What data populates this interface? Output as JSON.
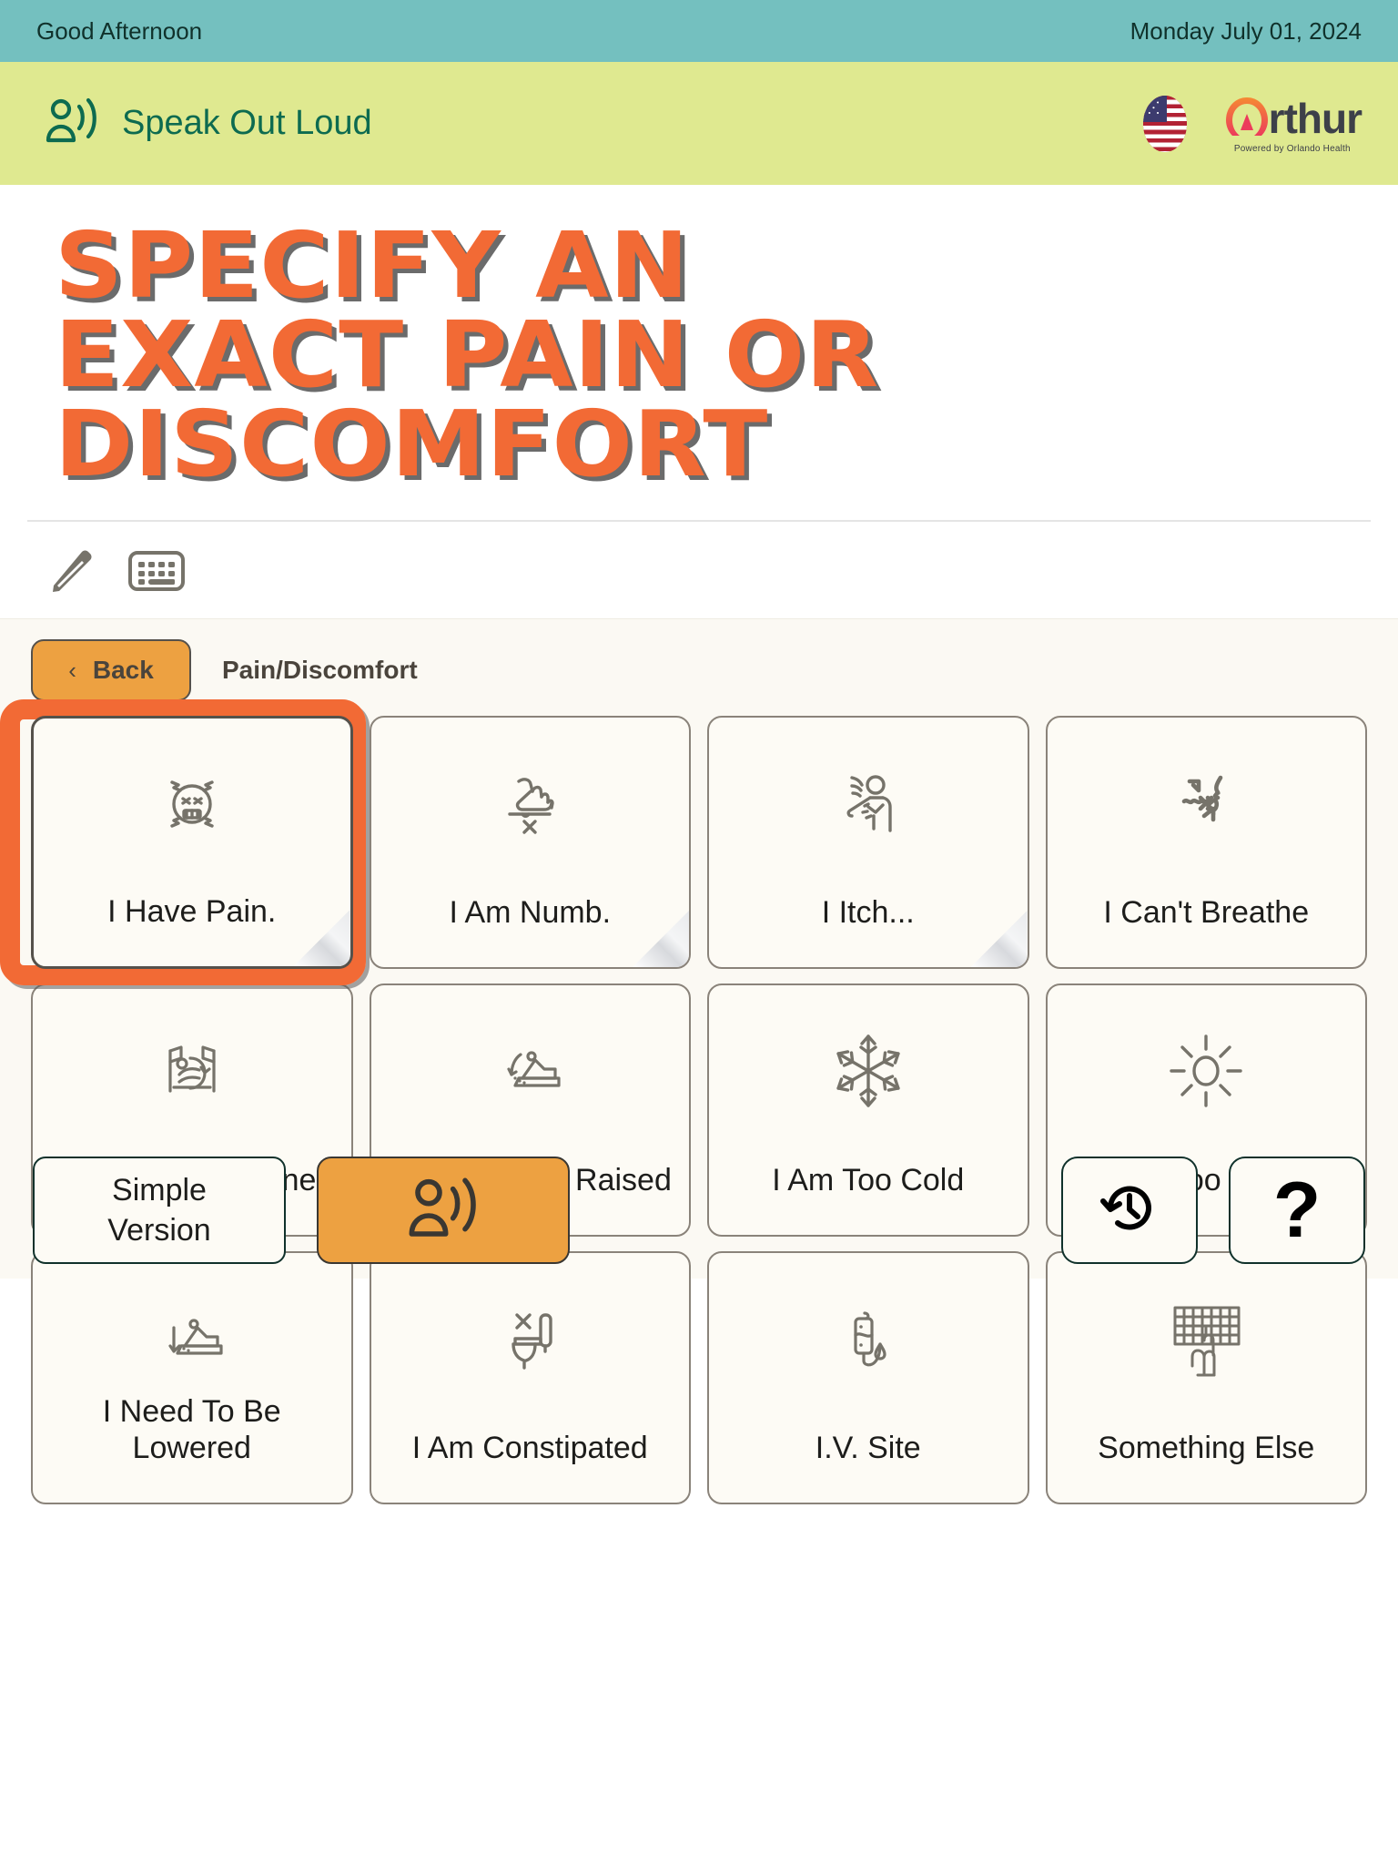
{
  "header": {
    "greeting": "Good Afternoon",
    "date": "Monday July 01, 2024"
  },
  "speak_bar": {
    "label": "Speak Out Loud",
    "speak_icon": "speak-out-loud-icon",
    "language_flag": "us-flag-icon",
    "brand": {
      "a_letter": "A",
      "rest": "rthur",
      "tagline": "Powered by Orlando Health"
    }
  },
  "page": {
    "title": "Specify An Exact Pain Or Discomfort",
    "title_lines": [
      "SPECIFY AN",
      "EXACT PAIN OR",
      "DISCOMFORT"
    ]
  },
  "toolbar": {
    "items": [
      {
        "name": "pencil-icon",
        "label": "Draw"
      },
      {
        "name": "keyboard-icon",
        "label": "Keyboard"
      }
    ]
  },
  "panel": {
    "back_label": "Back",
    "back_chevron": "‹",
    "breadcrumb": "Pain/Discomfort",
    "cards": [
      {
        "label": "I Have Pain.",
        "icon": "pain-face-icon",
        "curl": true,
        "selected": true
      },
      {
        "label": "I Am Numb.",
        "icon": "numb-hand-icon",
        "curl": true,
        "selected": false
      },
      {
        "label": "I Itch...",
        "icon": "itch-person-icon",
        "curl": true,
        "selected": false
      },
      {
        "label": "I Can't Breathe",
        "icon": "cant-breathe-icon",
        "curl": false,
        "selected": false
      },
      {
        "label": "I Need To Be Turned",
        "icon": "turn-in-bed-icon",
        "curl": false,
        "selected": false
      },
      {
        "label": "I Need To Be Raised",
        "icon": "raise-bed-icon",
        "curl": false,
        "selected": false
      },
      {
        "label": "I Am Too Cold",
        "icon": "snowflake-icon",
        "curl": false,
        "selected": false
      },
      {
        "label": "I Am Too Warm",
        "icon": "sun-icon",
        "curl": false,
        "selected": false
      },
      {
        "label": "I Need To Be Lowered",
        "icon": "lower-bed-icon",
        "curl": false,
        "selected": false
      },
      {
        "label": "I Am Constipated",
        "icon": "toilet-blocked-icon",
        "curl": false,
        "selected": false
      },
      {
        "label": "I.V. Site",
        "icon": "iv-drip-icon",
        "curl": false,
        "selected": false
      },
      {
        "label": "Something Else",
        "icon": "keyboard-typing-icon",
        "curl": false,
        "selected": false
      }
    ]
  },
  "bottom_bar": {
    "simple_version_line1": "Simple",
    "simple_version_line2": "Version",
    "speak_button_icon": "speak-out-loud-icon",
    "history_icon": "history-clock-icon",
    "help_label": "?"
  },
  "colors": {
    "greeting_bar": "#74c0bf",
    "speak_bar": "#dfe990",
    "title_orange": "#f26a35",
    "accent_orange": "#eda141",
    "panel_bg": "#fbf9f3",
    "card_bg": "#fdfbf5",
    "icon_gray": "#76736a"
  }
}
